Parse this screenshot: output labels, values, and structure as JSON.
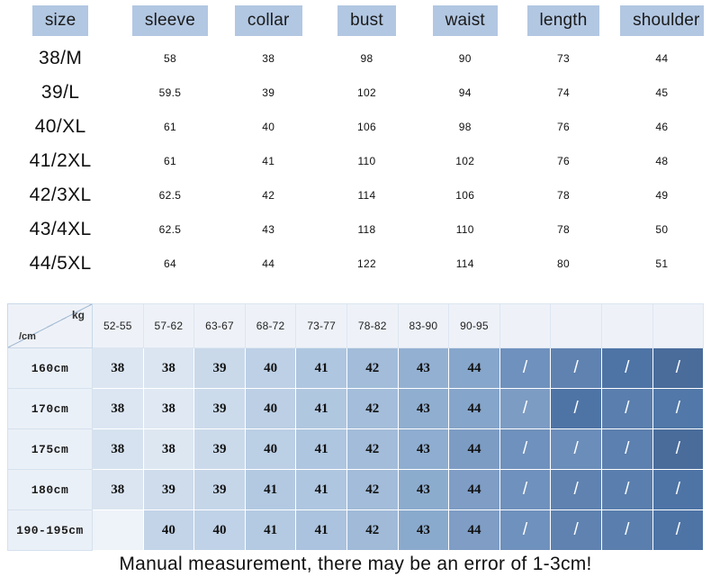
{
  "spec_table": {
    "headers": [
      "size",
      "sleeve",
      "collar",
      "bust",
      "waist",
      "length",
      "shoulder"
    ],
    "rows": [
      {
        "size": "38/M",
        "sleeve": "58",
        "collar": "38",
        "bust": "98",
        "waist": "90",
        "length": "73",
        "shoulder": "44"
      },
      {
        "size": "39/L",
        "sleeve": "59.5",
        "collar": "39",
        "bust": "102",
        "waist": "94",
        "length": "74",
        "shoulder": "45"
      },
      {
        "size": "40/XL",
        "sleeve": "61",
        "collar": "40",
        "bust": "106",
        "waist": "98",
        "length": "76",
        "shoulder": "46"
      },
      {
        "size": "41/2XL",
        "sleeve": "61",
        "collar": "41",
        "bust": "110",
        "waist": "102",
        "length": "76",
        "shoulder": "48"
      },
      {
        "size": "42/3XL",
        "sleeve": "62.5",
        "collar": "42",
        "bust": "114",
        "waist": "106",
        "length": "78",
        "shoulder": "49"
      },
      {
        "size": "43/4XL",
        "sleeve": "62.5",
        "collar": "43",
        "bust": "118",
        "waist": "110",
        "length": "78",
        "shoulder": "50"
      },
      {
        "size": "44/5XL",
        "sleeve": "64",
        "collar": "44",
        "bust": "122",
        "waist": "114",
        "length": "80",
        "shoulder": "51"
      }
    ],
    "header_bg": "#b2c7e2"
  },
  "fit_grid": {
    "corner": {
      "weight_label": "kg",
      "height_label": "/cm"
    },
    "weight_headers": [
      "52-55",
      "57-62",
      "63-67",
      "68-72",
      "73-77",
      "78-82",
      "83-90",
      "90-95",
      "",
      "",
      "",
      ""
    ],
    "rows": [
      {
        "height": "160cm",
        "values": [
          "38",
          "38",
          "39",
          "40",
          "41",
          "42",
          "43",
          "44",
          "/",
          "/",
          "/",
          "/"
        ],
        "shades": [
          "#dce6f2",
          "#dbe5f1",
          "#c9d9ea",
          "#bdd0e6",
          "#aec6e0",
          "#a2bcd9",
          "#93b0d2",
          "#87a6cb",
          "#6f91bd",
          "#5f82b0",
          "#4e74a6",
          "#4a6c9b"
        ]
      },
      {
        "height": "170cm",
        "values": [
          "38",
          "38",
          "39",
          "40",
          "41",
          "42",
          "43",
          "44",
          "/",
          "/",
          "/",
          "/"
        ],
        "shades": [
          "#dce6f2",
          "#dfe8f3",
          "#ccdbec",
          "#bccfe5",
          "#b0c7e0",
          "#a4bdda",
          "#90aed0",
          "#86a5ca",
          "#7d9cc4",
          "#4e74a6",
          "#5a7fae",
          "#5178a8"
        ]
      },
      {
        "height": "175cm",
        "values": [
          "38",
          "38",
          "39",
          "40",
          "41",
          "42",
          "43",
          "44",
          "/",
          "/",
          "/",
          "/"
        ],
        "shades": [
          "#d6e2ef",
          "#dde7f2",
          "#cbdaeb",
          "#bbcfe5",
          "#aec6e0",
          "#a2bcd9",
          "#8eadd0",
          "#7d9cc4",
          "#6f91bd",
          "#6b8dba",
          "#5c80af",
          "#4a6c9b"
        ]
      },
      {
        "height": "180cm",
        "values": [
          "38",
          "39",
          "39",
          "41",
          "41",
          "42",
          "43",
          "44",
          "/",
          "/",
          "/",
          "/"
        ],
        "shades": [
          "#dbe5f1",
          "#cedcec",
          "#c6d6e9",
          "#b3c9e2",
          "#aec6e0",
          "#a2bcd9",
          "#8cacce",
          "#7f9dc5",
          "#6f91bd",
          "#5f82b0",
          "#5a7fae",
          "#4e74a6"
        ]
      },
      {
        "height": "190-195cm",
        "values": [
          "",
          "40",
          "40",
          "41",
          "41",
          "42",
          "43",
          "44",
          "/",
          "/",
          "/",
          "/"
        ],
        "shades": [
          "#eef3f9",
          "#c3d4e8",
          "#c0d2e7",
          "#b4cae2",
          "#abc3de",
          "#a0bad8",
          "#8aaacd",
          "#7f9dc5",
          "#6f91bd",
          "#5f82b0",
          "#5a7fae",
          "#4e74a6"
        ]
      }
    ]
  },
  "footer": {
    "note": "Manual measurement, there may be an error of 1-3cm!"
  }
}
